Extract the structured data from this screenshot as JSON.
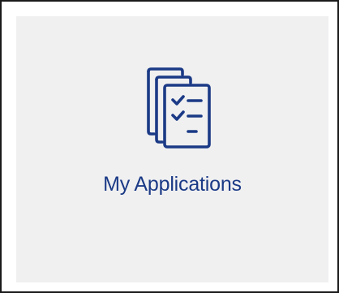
{
  "tile": {
    "label": "My Applications",
    "icon": "stacked-checklist-documents-icon"
  },
  "colors": {
    "accent": "#1b3a86",
    "tile_background": "#f0f0f1",
    "frame_border": "#1a1a1a",
    "page_background": "#ffffff"
  }
}
